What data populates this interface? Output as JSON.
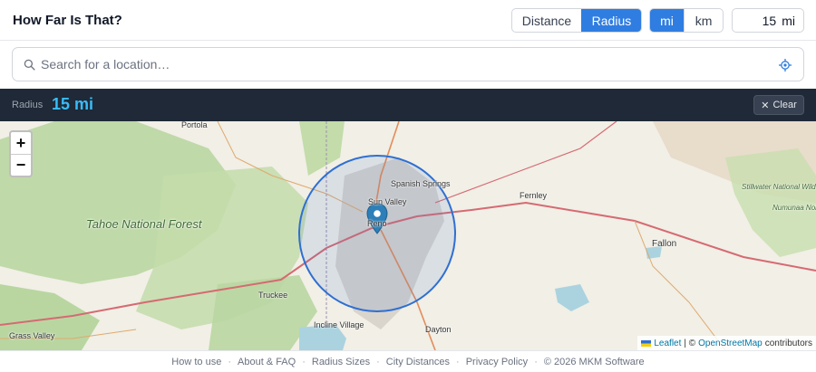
{
  "header": {
    "title": "How Far Is That?",
    "mode_options": [
      "Distance",
      "Radius"
    ],
    "mode_selected": "Radius",
    "unit_options": [
      "mi",
      "km"
    ],
    "unit_selected": "mi",
    "radius_value": "15",
    "radius_unit": "mi"
  },
  "search": {
    "placeholder": "Search for a location…",
    "value": ""
  },
  "radius_bar": {
    "label": "Radius",
    "value": "15 mi",
    "clear_label": "Clear"
  },
  "map": {
    "zoom_in": "+",
    "zoom_out": "−",
    "labels": {
      "portola": "Portola",
      "tahoe_forest": "Tahoe National Forest",
      "spanish_springs": "Spanish Springs",
      "sun_valley": "Sun Valley",
      "reno": "Reno",
      "fernley": "Fernley",
      "fallon": "Fallon",
      "stillwater_refuge": "Stillwater National Wildlife Refuge",
      "numunaa_area": "Numunaa Nobe National Conservation Area",
      "truckee": "Truckee",
      "incline_village": "Incline Village",
      "dayton": "Dayton",
      "grass_valley": "Grass Valley"
    },
    "attribution": {
      "leaflet": "Leaflet",
      "separator": "| ©",
      "osm": "OpenStreetMap",
      "contributors": "contributors"
    },
    "colors": {
      "circle_stroke": "#2f6fd1",
      "marker": "#2c7fb8",
      "forest": "#b9d6a1",
      "water": "#aad3df"
    }
  },
  "footer": {
    "links": [
      "How to use",
      "About & FAQ",
      "Radius Sizes",
      "City Distances",
      "Privacy Policy"
    ],
    "copyright": "© 2026 MKM Software"
  },
  "colors": {
    "accent": "#2f7de1",
    "radius_value": "#38bdf8",
    "bar_bg": "#1f2937"
  }
}
